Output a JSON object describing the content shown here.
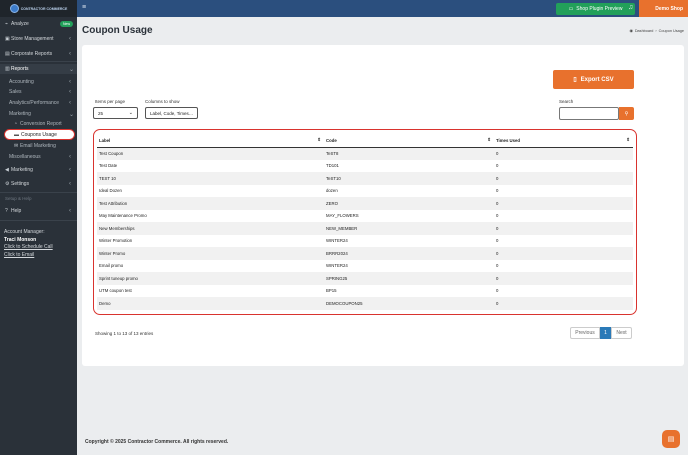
{
  "brand": {
    "logo_text": "CONTRACTOR COMMERCE"
  },
  "sidebar": {
    "analyze": "Analyze",
    "analyze_badge": "New",
    "store_management": "Store Management",
    "corporate_reports": "Corporate Reports",
    "reports": "Reports",
    "accounting": "Accounting",
    "sales": "Sales",
    "analytics": "Analytics/Performance",
    "marketing_sub": "Marketing",
    "conversion_report": "Conversion Report",
    "coupons_usage": "Coupons Usage",
    "email_marketing": "Email Marketing",
    "miscellaneous": "Miscellaneous",
    "marketing": "Marketing",
    "settings": "Settings",
    "setup_help": "Setup & Help",
    "help": "Help",
    "account_manager_label": "Account Manager:",
    "account_manager_name": "Traci Monson",
    "schedule_call": "Click to Schedule Call",
    "email_link": "Click to Email"
  },
  "topbar": {
    "preview_label": "Shop Plugin Preview",
    "shop_name": "Demo Shop"
  },
  "page": {
    "title": "Coupon Usage",
    "breadcrumb": [
      "Dashboard",
      "Coupon Usage"
    ]
  },
  "toolbar": {
    "export_label": "Export CSV",
    "items_per_page_label": "Items per page",
    "items_per_page_value": "25",
    "columns_label": "Columns to show",
    "columns_value": "Label, Code, Times…",
    "search_label": "Search",
    "search_value": ""
  },
  "table": {
    "headers": [
      "Label",
      "Code",
      "Times Used"
    ],
    "rows": [
      [
        "Test Coupon",
        "TeST8",
        "0"
      ],
      [
        "Test Date",
        "TD101",
        "0"
      ],
      [
        "TEST 10",
        "TeST10",
        "0"
      ],
      [
        "Ideal Dozen",
        "dozen",
        "0"
      ],
      [
        "Test Attribution",
        "ZERO",
        "0"
      ],
      [
        "May Maintenance Promo",
        "MAY_FLOWERS",
        "0"
      ],
      [
        "New Memberships",
        "NEW_MEMBER",
        "0"
      ],
      [
        "Winter Promotion",
        "WINTER24",
        "0"
      ],
      [
        "Winter Promo",
        "BRRR2024",
        "0"
      ],
      [
        "Email promo",
        "WINTER24",
        "0"
      ],
      [
        "Sprint tuneup promo",
        "SPRING25",
        "0"
      ],
      [
        "UTM coupon test",
        "BP15",
        "0"
      ],
      [
        "Demo",
        "DEMOCOUPON25",
        "0"
      ]
    ]
  },
  "pagination": {
    "summary": "Showing 1 to 13 of 13 entries",
    "previous": "Previous",
    "current": "1",
    "next": "Next"
  },
  "footer": {
    "copyright": "Copyright © 2025 Contractor Commerce. All rights reserved."
  },
  "colors": {
    "accent": "#e8712d",
    "highlight": "#d9332e",
    "sidebar": "#2a3139",
    "topbar": "#2b4f7e",
    "success": "#22a05a"
  }
}
